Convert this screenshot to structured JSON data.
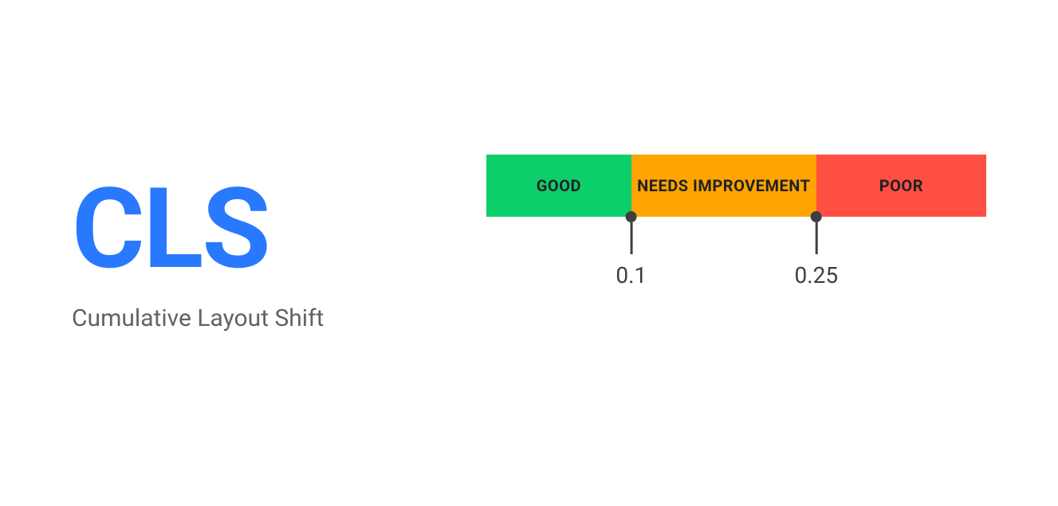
{
  "metric": {
    "abbr": "CLS",
    "full": "Cumulative Layout Shift"
  },
  "scale": {
    "segments": [
      {
        "label": "GOOD",
        "color": "#0cce6b"
      },
      {
        "label": "NEEDS IMPROVEMENT",
        "color": "#ffa400"
      },
      {
        "label": "POOR",
        "color": "#ff4e42"
      }
    ],
    "thresholds": {
      "good_upper": "0.1",
      "needs_upper": "0.25"
    }
  }
}
